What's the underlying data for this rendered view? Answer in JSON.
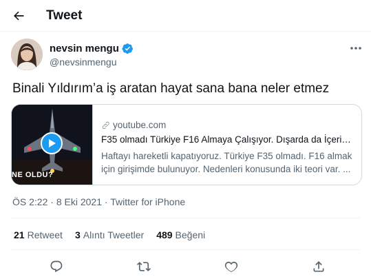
{
  "header": {
    "title": "Tweet",
    "back_icon": "arrow-left-icon"
  },
  "author": {
    "name": "nevsin mengu",
    "handle": "@nevsinmengu",
    "verified_color": "#1d9bf0"
  },
  "tweet": {
    "text": "Binali Yıldırım’a iş aratan hayat sana bana neler etmez"
  },
  "card": {
    "domain": "youtube.com",
    "title": "F35 olmadı Türkiye F16 Almaya Çalışıyor. Dışarda da İçeride...",
    "description": "Haftayı hareketli kapatıyoruz. Türkiye F35 olmadı. F16 almak için girişimde bulunuyor. Nedenleri konusunda iki teori var. ...",
    "thumbnail_text": "NE OLDU?",
    "play_color": "#1d9bf0"
  },
  "meta": {
    "time": "ÖS 2:22",
    "separator": "·",
    "date": "8 Eki 2021",
    "source": "Twitter for iPhone"
  },
  "stats": {
    "retweets": {
      "count": "21",
      "label": "Retweet"
    },
    "quotes": {
      "count": "3",
      "label": "Alıntı Tweetler"
    },
    "likes": {
      "count": "489",
      "label": "Beğeni"
    }
  },
  "actions": [
    "reply-icon",
    "retweet-icon",
    "like-icon",
    "share-icon"
  ],
  "colors": {
    "text": "#0f1419",
    "secondary": "#536471",
    "border": "#cfd9de",
    "accent": "#1d9bf0"
  }
}
